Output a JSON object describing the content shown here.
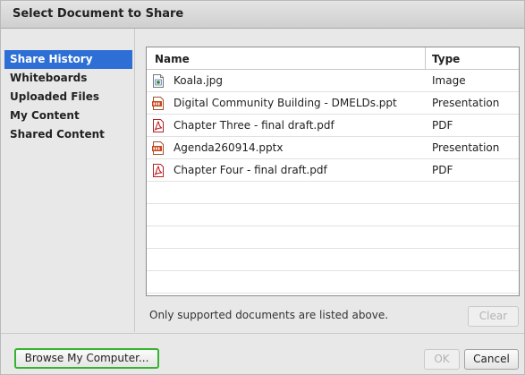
{
  "dialog": {
    "title": "Select Document to Share"
  },
  "sidebar": {
    "items": [
      {
        "label": "Share History",
        "active": true
      },
      {
        "label": "Whiteboards",
        "active": false
      },
      {
        "label": "Uploaded Files",
        "active": false
      },
      {
        "label": "My Content",
        "active": false
      },
      {
        "label": "Shared Content",
        "active": false
      }
    ]
  },
  "filelist": {
    "columns": {
      "name": "Name",
      "type": "Type"
    },
    "rows": [
      {
        "name": "Koala.jpg",
        "type": "Image",
        "icon": "image-file-icon"
      },
      {
        "name": "Digital Community Building - DMELDs.ppt",
        "type": "Presentation",
        "icon": "presentation-file-icon"
      },
      {
        "name": "Chapter Three - final draft.pdf",
        "type": "PDF",
        "icon": "pdf-file-icon"
      },
      {
        "name": "Agenda260914.pptx",
        "type": "Presentation",
        "icon": "presentation-file-icon"
      },
      {
        "name": "Chapter Four - final draft.pdf",
        "type": "PDF",
        "icon": "pdf-file-icon"
      }
    ]
  },
  "footer": {
    "note": "Only supported documents are listed above.",
    "clear_label": "Clear",
    "browse_label": "Browse My Computer...",
    "ok_label": "OK",
    "cancel_label": "Cancel"
  },
  "colors": {
    "selection": "#2e6fd6",
    "focus_outline": "#35b52f"
  }
}
